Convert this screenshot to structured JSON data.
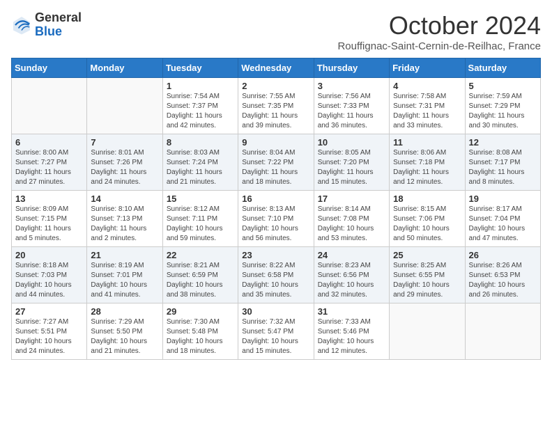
{
  "logo": {
    "general": "General",
    "blue": "Blue"
  },
  "title": "October 2024",
  "location": "Rouffignac-Saint-Cernin-de-Reilhac, France",
  "days_of_week": [
    "Sunday",
    "Monday",
    "Tuesday",
    "Wednesday",
    "Thursday",
    "Friday",
    "Saturday"
  ],
  "weeks": [
    [
      {
        "day": "",
        "sunrise": "",
        "sunset": "",
        "daylight": ""
      },
      {
        "day": "",
        "sunrise": "",
        "sunset": "",
        "daylight": ""
      },
      {
        "day": "1",
        "sunrise": "Sunrise: 7:54 AM",
        "sunset": "Sunset: 7:37 PM",
        "daylight": "Daylight: 11 hours and 42 minutes."
      },
      {
        "day": "2",
        "sunrise": "Sunrise: 7:55 AM",
        "sunset": "Sunset: 7:35 PM",
        "daylight": "Daylight: 11 hours and 39 minutes."
      },
      {
        "day": "3",
        "sunrise": "Sunrise: 7:56 AM",
        "sunset": "Sunset: 7:33 PM",
        "daylight": "Daylight: 11 hours and 36 minutes."
      },
      {
        "day": "4",
        "sunrise": "Sunrise: 7:58 AM",
        "sunset": "Sunset: 7:31 PM",
        "daylight": "Daylight: 11 hours and 33 minutes."
      },
      {
        "day": "5",
        "sunrise": "Sunrise: 7:59 AM",
        "sunset": "Sunset: 7:29 PM",
        "daylight": "Daylight: 11 hours and 30 minutes."
      }
    ],
    [
      {
        "day": "6",
        "sunrise": "Sunrise: 8:00 AM",
        "sunset": "Sunset: 7:27 PM",
        "daylight": "Daylight: 11 hours and 27 minutes."
      },
      {
        "day": "7",
        "sunrise": "Sunrise: 8:01 AM",
        "sunset": "Sunset: 7:26 PM",
        "daylight": "Daylight: 11 hours and 24 minutes."
      },
      {
        "day": "8",
        "sunrise": "Sunrise: 8:03 AM",
        "sunset": "Sunset: 7:24 PM",
        "daylight": "Daylight: 11 hours and 21 minutes."
      },
      {
        "day": "9",
        "sunrise": "Sunrise: 8:04 AM",
        "sunset": "Sunset: 7:22 PM",
        "daylight": "Daylight: 11 hours and 18 minutes."
      },
      {
        "day": "10",
        "sunrise": "Sunrise: 8:05 AM",
        "sunset": "Sunset: 7:20 PM",
        "daylight": "Daylight: 11 hours and 15 minutes."
      },
      {
        "day": "11",
        "sunrise": "Sunrise: 8:06 AM",
        "sunset": "Sunset: 7:18 PM",
        "daylight": "Daylight: 11 hours and 12 minutes."
      },
      {
        "day": "12",
        "sunrise": "Sunrise: 8:08 AM",
        "sunset": "Sunset: 7:17 PM",
        "daylight": "Daylight: 11 hours and 8 minutes."
      }
    ],
    [
      {
        "day": "13",
        "sunrise": "Sunrise: 8:09 AM",
        "sunset": "Sunset: 7:15 PM",
        "daylight": "Daylight: 11 hours and 5 minutes."
      },
      {
        "day": "14",
        "sunrise": "Sunrise: 8:10 AM",
        "sunset": "Sunset: 7:13 PM",
        "daylight": "Daylight: 11 hours and 2 minutes."
      },
      {
        "day": "15",
        "sunrise": "Sunrise: 8:12 AM",
        "sunset": "Sunset: 7:11 PM",
        "daylight": "Daylight: 10 hours and 59 minutes."
      },
      {
        "day": "16",
        "sunrise": "Sunrise: 8:13 AM",
        "sunset": "Sunset: 7:10 PM",
        "daylight": "Daylight: 10 hours and 56 minutes."
      },
      {
        "day": "17",
        "sunrise": "Sunrise: 8:14 AM",
        "sunset": "Sunset: 7:08 PM",
        "daylight": "Daylight: 10 hours and 53 minutes."
      },
      {
        "day": "18",
        "sunrise": "Sunrise: 8:15 AM",
        "sunset": "Sunset: 7:06 PM",
        "daylight": "Daylight: 10 hours and 50 minutes."
      },
      {
        "day": "19",
        "sunrise": "Sunrise: 8:17 AM",
        "sunset": "Sunset: 7:04 PM",
        "daylight": "Daylight: 10 hours and 47 minutes."
      }
    ],
    [
      {
        "day": "20",
        "sunrise": "Sunrise: 8:18 AM",
        "sunset": "Sunset: 7:03 PM",
        "daylight": "Daylight: 10 hours and 44 minutes."
      },
      {
        "day": "21",
        "sunrise": "Sunrise: 8:19 AM",
        "sunset": "Sunset: 7:01 PM",
        "daylight": "Daylight: 10 hours and 41 minutes."
      },
      {
        "day": "22",
        "sunrise": "Sunrise: 8:21 AM",
        "sunset": "Sunset: 6:59 PM",
        "daylight": "Daylight: 10 hours and 38 minutes."
      },
      {
        "day": "23",
        "sunrise": "Sunrise: 8:22 AM",
        "sunset": "Sunset: 6:58 PM",
        "daylight": "Daylight: 10 hours and 35 minutes."
      },
      {
        "day": "24",
        "sunrise": "Sunrise: 8:23 AM",
        "sunset": "Sunset: 6:56 PM",
        "daylight": "Daylight: 10 hours and 32 minutes."
      },
      {
        "day": "25",
        "sunrise": "Sunrise: 8:25 AM",
        "sunset": "Sunset: 6:55 PM",
        "daylight": "Daylight: 10 hours and 29 minutes."
      },
      {
        "day": "26",
        "sunrise": "Sunrise: 8:26 AM",
        "sunset": "Sunset: 6:53 PM",
        "daylight": "Daylight: 10 hours and 26 minutes."
      }
    ],
    [
      {
        "day": "27",
        "sunrise": "Sunrise: 7:27 AM",
        "sunset": "Sunset: 5:51 PM",
        "daylight": "Daylight: 10 hours and 24 minutes."
      },
      {
        "day": "28",
        "sunrise": "Sunrise: 7:29 AM",
        "sunset": "Sunset: 5:50 PM",
        "daylight": "Daylight: 10 hours and 21 minutes."
      },
      {
        "day": "29",
        "sunrise": "Sunrise: 7:30 AM",
        "sunset": "Sunset: 5:48 PM",
        "daylight": "Daylight: 10 hours and 18 minutes."
      },
      {
        "day": "30",
        "sunrise": "Sunrise: 7:32 AM",
        "sunset": "Sunset: 5:47 PM",
        "daylight": "Daylight: 10 hours and 15 minutes."
      },
      {
        "day": "31",
        "sunrise": "Sunrise: 7:33 AM",
        "sunset": "Sunset: 5:46 PM",
        "daylight": "Daylight: 10 hours and 12 minutes."
      },
      {
        "day": "",
        "sunrise": "",
        "sunset": "",
        "daylight": ""
      },
      {
        "day": "",
        "sunrise": "",
        "sunset": "",
        "daylight": ""
      }
    ]
  ]
}
